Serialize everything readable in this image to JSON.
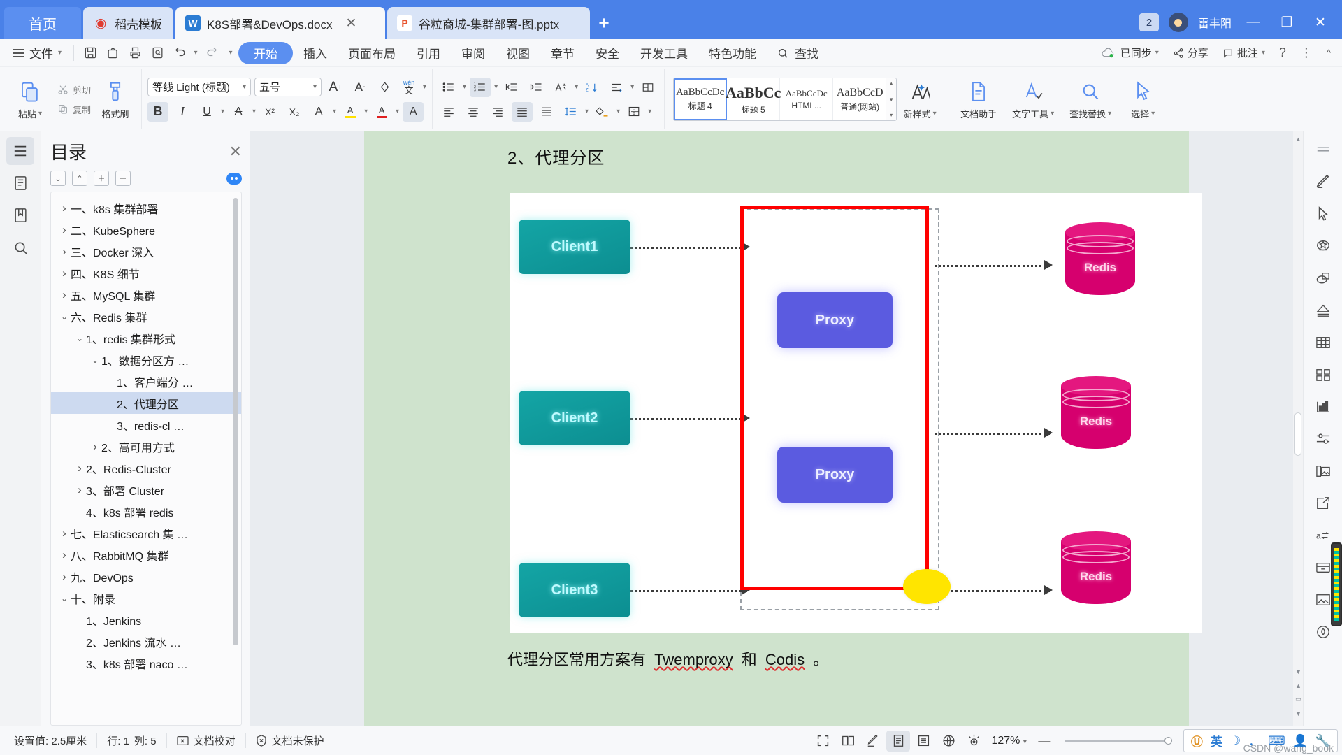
{
  "window": {
    "home_tab": "首页",
    "tabs": [
      {
        "label": "稻壳模板",
        "icon": "dove-icon",
        "type": "d",
        "active": false,
        "closable": false
      },
      {
        "label": "K8S部署&DevOps.docx",
        "icon": "word-icon",
        "type": "w",
        "active": true,
        "closable": true
      },
      {
        "label": "谷粒商城-集群部署-图.pptx",
        "icon": "powerpoint-icon",
        "type": "p",
        "active": false,
        "closable": false
      }
    ],
    "new_tab": "+",
    "notification_count": "2",
    "user_name": "雷丰阳",
    "minimize": "—",
    "maximize": "❐",
    "close": "✕"
  },
  "ribbon_tabs": {
    "file_label": "文件",
    "quick_icons": [
      "save-icon",
      "save-as-icon",
      "print-icon",
      "print-preview-icon",
      "undo-icon",
      "redo-icon",
      "customize-icon"
    ],
    "tabs": [
      "开始",
      "插入",
      "页面布局",
      "引用",
      "审阅",
      "视图",
      "章节",
      "安全",
      "开发工具",
      "特色功能"
    ],
    "active_tab": "开始",
    "search_label": "查找",
    "right_items": [
      {
        "label": "已同步",
        "icon": "cloud-sync-icon"
      },
      {
        "label": "分享",
        "icon": "share-icon"
      },
      {
        "label": "批注",
        "icon": "comment-icon"
      }
    ],
    "help": "?",
    "more": "⋮",
    "collapse": "^"
  },
  "ribbon": {
    "clipboard": {
      "paste_label": "粘贴",
      "cut_label": "剪切",
      "copy_label": "复制",
      "format_painter_label": "格式刷"
    },
    "font": {
      "family": "等线 Light (标题)",
      "size": "五号",
      "grow_label": "A",
      "shrink_label": "A",
      "clear_format": "clear-format-icon",
      "pinyin_label": "文",
      "bold": "B",
      "italic": "I",
      "underline": "U",
      "strike": "A",
      "superscript": "X²",
      "subscript": "X₂",
      "char_border": "A",
      "highlight": "A",
      "font_color": "A",
      "char_shading": "A"
    },
    "paragraph": {
      "bullets": "bullet-list-icon",
      "numbering": "numbered-list-icon",
      "multilevel": "multilevel-list-icon",
      "decrease_indent": "decrease-indent-icon",
      "increase_indent": "increase-indent-icon",
      "asian_layout": "asian-layout-icon",
      "sort": "sort-icon",
      "show_marks": "show-marks-icon",
      "align_left": "align-left-icon",
      "align_center": "align-center-icon",
      "align_right": "align-right-icon",
      "align_justify": "align-justify-icon",
      "distribute": "distribute-icon",
      "line_spacing": "line-spacing-icon",
      "shading": "shading-icon",
      "borders": "borders-icon"
    },
    "styles": {
      "items": [
        {
          "sample": "AaBbCcDc",
          "name": "标题 4",
          "selected": true
        },
        {
          "sample": "AaBbCc",
          "name": "标题 5",
          "selected": false
        },
        {
          "sample": "AaBbCcDc",
          "name": "HTML...",
          "selected": false
        },
        {
          "sample": "AaBbCcD",
          "name": "普通(网站)",
          "selected": false
        }
      ],
      "new_style_label": "新样式"
    },
    "tools": [
      {
        "label": "文档助手",
        "icon": "doc-assistant-icon"
      },
      {
        "label": "文字工具",
        "icon": "text-tools-icon"
      },
      {
        "label": "查找替换",
        "icon": "find-replace-icon"
      },
      {
        "label": "选择",
        "icon": "select-icon"
      }
    ]
  },
  "toc": {
    "title": "目录",
    "close": "✕",
    "tools": [
      "expand-all-icon",
      "collapse-all-icon",
      "plus-icon",
      "minus-icon"
    ],
    "items": [
      {
        "label": "一、k8s 集群部署",
        "indent": 0,
        "chevron": "right",
        "selected": false
      },
      {
        "label": "二、KubeSphere",
        "indent": 0,
        "chevron": "right",
        "selected": false
      },
      {
        "label": "三、Docker 深入",
        "indent": 0,
        "chevron": "right",
        "selected": false
      },
      {
        "label": "四、K8S 细节",
        "indent": 0,
        "chevron": "right",
        "selected": false
      },
      {
        "label": "五、MySQL 集群",
        "indent": 0,
        "chevron": "right",
        "selected": false
      },
      {
        "label": "六、Redis 集群",
        "indent": 0,
        "chevron": "down",
        "selected": false
      },
      {
        "label": "1、redis 集群形式",
        "indent": 1,
        "chevron": "down",
        "selected": false
      },
      {
        "label": "1、数据分区方 …",
        "indent": 2,
        "chevron": "down",
        "selected": false
      },
      {
        "label": "1、客户端分 …",
        "indent": 3,
        "chevron": "none",
        "selected": false
      },
      {
        "label": "2、代理分区",
        "indent": 3,
        "chevron": "none",
        "selected": true
      },
      {
        "label": "3、redis-cl …",
        "indent": 3,
        "chevron": "none",
        "selected": false
      },
      {
        "label": "2、高可用方式",
        "indent": 2,
        "chevron": "right",
        "selected": false
      },
      {
        "label": "2、Redis-Cluster",
        "indent": 1,
        "chevron": "right",
        "selected": false
      },
      {
        "label": "3、部署 Cluster",
        "indent": 1,
        "chevron": "right",
        "selected": false
      },
      {
        "label": "4、k8s 部署 redis",
        "indent": 1,
        "chevron": "none",
        "selected": false
      },
      {
        "label": "七、Elasticsearch 集 …",
        "indent": 0,
        "chevron": "right",
        "selected": false
      },
      {
        "label": "八、RabbitMQ 集群",
        "indent": 0,
        "chevron": "right",
        "selected": false
      },
      {
        "label": "九、DevOps",
        "indent": 0,
        "chevron": "right",
        "selected": false
      },
      {
        "label": "十、附录",
        "indent": 0,
        "chevron": "down",
        "selected": false
      },
      {
        "label": "1、Jenkins",
        "indent": 1,
        "chevron": "none",
        "selected": false
      },
      {
        "label": "2、Jenkins 流水 …",
        "indent": 1,
        "chevron": "none",
        "selected": false
      },
      {
        "label": "3、k8s 部署 naco …",
        "indent": 1,
        "chevron": "none",
        "selected": false
      }
    ]
  },
  "document": {
    "heading": "2、代理分区",
    "caption_prefix": "代理分区常用方案有",
    "caption_link1": "Twemproxy",
    "caption_and": "和",
    "caption_link2": "Codis",
    "caption_suffix": "。",
    "diagram": {
      "clients": [
        "Client1",
        "Client2",
        "Client3"
      ],
      "proxies": [
        "Proxy",
        "Proxy"
      ],
      "stores": [
        "Redis",
        "Redis",
        "Redis"
      ],
      "client_color": "#0c8e91",
      "proxy_color": "#5b5be0",
      "store_color": "#d6006e",
      "highlight_color": "#ff0000",
      "marker_color": "#ffe500"
    }
  },
  "status": {
    "setting_value": "设置值: 2.5厘米",
    "row": "行: 1",
    "col": "列: 5",
    "proofread": "文档校对",
    "protection": "文档未保护",
    "view_icons": [
      "fullscreen-icon",
      "two-page-icon",
      "pen-icon",
      "page-view-icon",
      "outline-view-icon",
      "web-view-icon",
      "eye-protection-icon"
    ],
    "zoom": "127%",
    "zoom_minus": "—",
    "ime": [
      "ime-logo-icon",
      "英",
      "moon-icon",
      "punctuation-icon",
      "keyboard-icon",
      "user-icon",
      "tools-icon"
    ],
    "watermark": "CSDN @wang_book"
  }
}
